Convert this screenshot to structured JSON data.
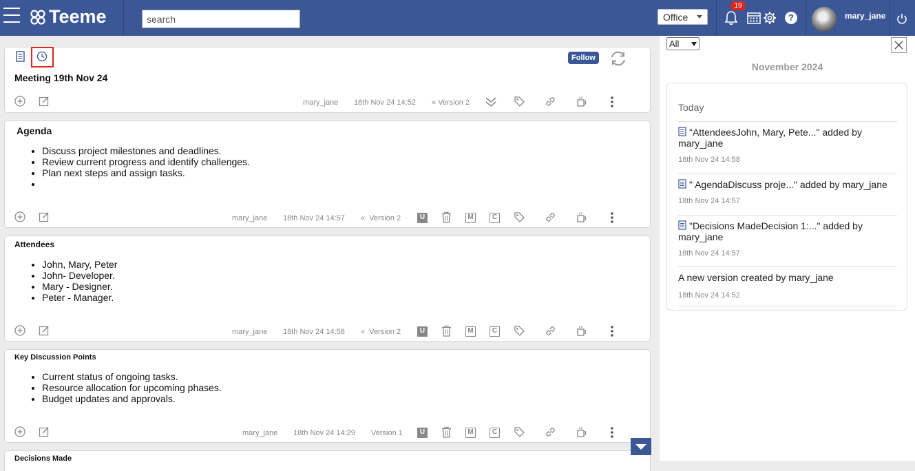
{
  "app": {
    "name": "Teeme"
  },
  "header": {
    "search_placeholder": "search",
    "workspace": "Office",
    "notification_count": "19",
    "help_label": "?",
    "username": "mary_jane"
  },
  "document": {
    "title": "Meeting 19th Nov 24",
    "follow_label": "Follow",
    "author": "mary_jane",
    "timestamp": "18th Nov 24 14:52",
    "version": "Version 2"
  },
  "sections": [
    {
      "title": "Agenda",
      "items": [
        "Discuss project milestones and deadlines.",
        "Review current progress and identify challenges.",
        "Plan next steps and assign tasks.",
        ""
      ],
      "author": "mary_jane",
      "timestamp": "18th Nov 24 14:57",
      "version": "Version 2",
      "badges": [
        "U",
        "M",
        "C"
      ]
    },
    {
      "title": "Attendees",
      "items": [
        "John, Mary, Peter",
        "John- Developer.",
        "Mary - Designer.",
        "Peter - Manager."
      ],
      "author": "mary_jane",
      "timestamp": "18th Nov 24 14:58",
      "version": "Version 2",
      "badges": [
        "U",
        "M",
        "C"
      ]
    },
    {
      "title": "Key Discussion Points",
      "items": [
        "Current status of ongoing tasks.",
        "Resource allocation for upcoming phases.",
        "Budget updates and approvals."
      ],
      "author": "mary_jane",
      "timestamp": "18th Nov 24 14:29",
      "version": "Version 1",
      "badges": [
        "U",
        "M",
        "C"
      ]
    },
    {
      "title": "Decisions Made"
    }
  ],
  "panel": {
    "filter": "All",
    "month": "November 2024",
    "group_label": "Today",
    "activities": [
      {
        "text": "\"AttendeesJohn, Mary, Pete...\" added by mary_jane",
        "time": "18th Nov 24 14:58",
        "icon": "document-icon"
      },
      {
        "text": "\" AgendaDiscuss proje...\" added by mary_jane",
        "time": "18th Nov 24 14:57",
        "icon": "document-icon"
      },
      {
        "text": "\"Decisions MadeDecision 1:...\" added by mary_jane",
        "time": "18th Nov 24 14:57",
        "icon": "document-icon"
      },
      {
        "text": "A new version created by mary_jane",
        "time": "18th Nov 24 14:52",
        "icon": ""
      }
    ]
  },
  "colors": {
    "header": "#3b5796",
    "highlight": "#e0261f",
    "badge": "#e0261f"
  }
}
